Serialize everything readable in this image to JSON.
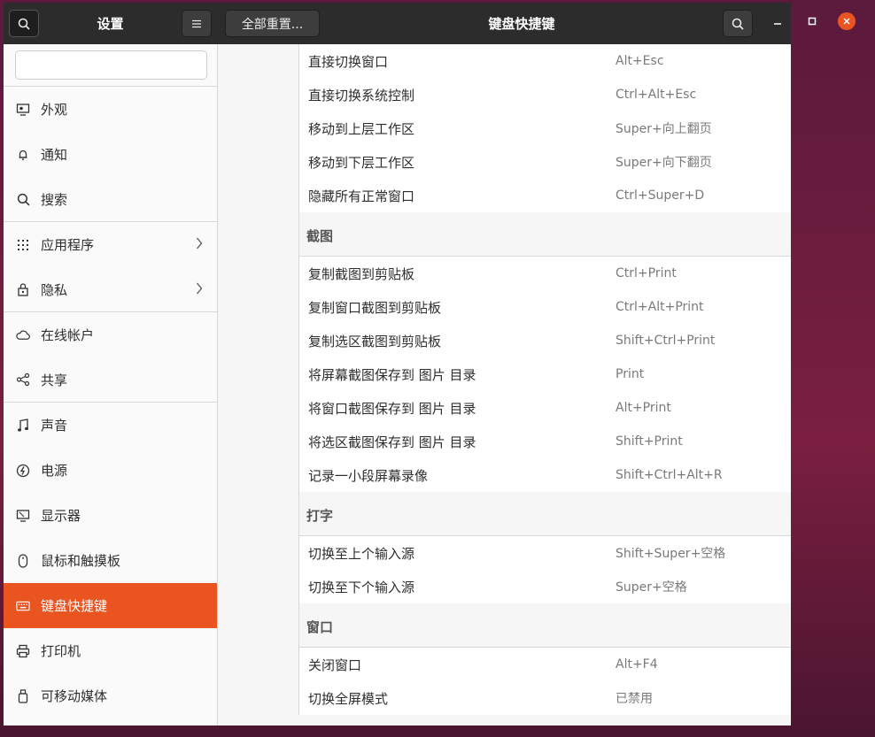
{
  "titlebar": {
    "settings_title": "设置",
    "reset_label": "全部重置...",
    "page_title": "键盘快捷键"
  },
  "sidebar": {
    "search_placeholder": "",
    "items": [
      {
        "label": "外观",
        "icon": "display-appearance-icon"
      },
      {
        "label": "通知",
        "icon": "bell-icon"
      },
      {
        "label": "搜索",
        "icon": "search-icon"
      },
      {
        "label": "应用程序",
        "icon": "grid-icon"
      },
      {
        "label": "隐私",
        "icon": "lock-icon"
      },
      {
        "label": "在线帐户",
        "icon": "cloud-icon"
      },
      {
        "label": "共享",
        "icon": "share-icon"
      },
      {
        "label": "声音",
        "icon": "music-note-icon"
      },
      {
        "label": "电源",
        "icon": "power-icon"
      },
      {
        "label": "显示器",
        "icon": "monitor-icon"
      },
      {
        "label": "鼠标和触摸板",
        "icon": "mouse-icon"
      },
      {
        "label": "键盘快捷键",
        "icon": "keyboard-icon"
      },
      {
        "label": "打印机",
        "icon": "printer-icon"
      },
      {
        "label": "可移动媒体",
        "icon": "usb-media-icon"
      }
    ]
  },
  "shortcuts": {
    "top": [
      {
        "name": "直接切换窗口",
        "accel": "Alt+Esc"
      },
      {
        "name": "直接切换系统控制",
        "accel": "Ctrl+Alt+Esc"
      },
      {
        "name": "移动到上层工作区",
        "accel": "Super+向上翻页"
      },
      {
        "name": "移动到下层工作区",
        "accel": "Super+向下翻页"
      },
      {
        "name": "隐藏所有正常窗口",
        "accel": "Ctrl+Super+D"
      }
    ],
    "screenshot_header": "截图",
    "screenshot": [
      {
        "name": "复制截图到剪贴板",
        "accel": "Ctrl+Print"
      },
      {
        "name": "复制窗口截图到剪贴板",
        "accel": "Ctrl+Alt+Print"
      },
      {
        "name": "复制选区截图到剪贴板",
        "accel": "Shift+Ctrl+Print"
      },
      {
        "name": "将屏幕截图保存到 图片 目录",
        "accel": "Print"
      },
      {
        "name": "将窗口截图保存到 图片 目录",
        "accel": "Alt+Print"
      },
      {
        "name": "将选区截图保存到 图片 目录",
        "accel": "Shift+Print"
      },
      {
        "name": "记录一小段屏幕录像",
        "accel": "Shift+Ctrl+Alt+R"
      }
    ],
    "typing_header": "打字",
    "typing": [
      {
        "name": "切换至上个输入源",
        "accel": "Shift+Super+空格"
      },
      {
        "name": "切换至下个输入源",
        "accel": "Super+空格"
      }
    ],
    "window_header": "窗口",
    "window": [
      {
        "name": "关闭窗口",
        "accel": "Alt+F4"
      },
      {
        "name": "切换全屏模式",
        "accel": "已禁用"
      }
    ]
  },
  "colors": {
    "accent": "#e95420",
    "titlebar": "#2c2c2c"
  }
}
